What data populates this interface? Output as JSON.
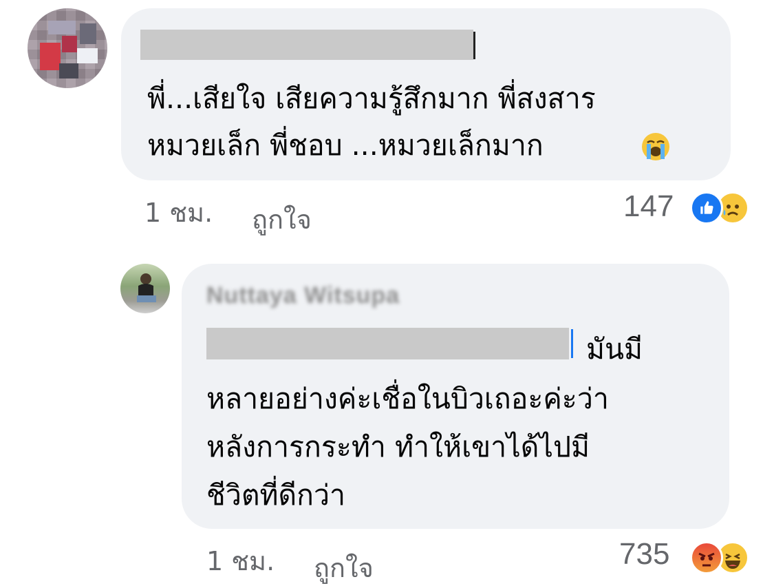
{
  "comments": [
    {
      "text_line_1": "พี่...เสียใจ เสียความรู้สึกมาก พี่สงสาร",
      "text_line_2": "หมวยเล็ก พี่ชอบ ...หมวยเล็กมาก",
      "inline_emoji": "loudly-crying-face-icon",
      "time": "1 ชม.",
      "like_label": "ถูกใจ",
      "reaction_count": "147",
      "reactions": [
        "like-icon",
        "sad-icon"
      ]
    },
    {
      "author_blurred": "Nuttaya Witsupa",
      "text_line_1": "มันมี",
      "text_line_2": "หลายอย่างค่ะเชื่อในบิวเถอะค่ะว่า",
      "text_line_3": "หลังการกระทำ ทำให้เขาได้ไปมี",
      "text_line_4": "ชีวิตที่ดีกว่า",
      "time": "1 ชม.",
      "like_label": "ถูกใจ",
      "reaction_count": "735",
      "reactions": [
        "angry-icon",
        "haha-icon"
      ]
    }
  ],
  "colors": {
    "bubble": "#f0f2f5",
    "meta_text": "#65676b",
    "like_blue": "#1877f2",
    "reaction_yellow": "#f7c63b",
    "angry_red": "#e9493a"
  }
}
